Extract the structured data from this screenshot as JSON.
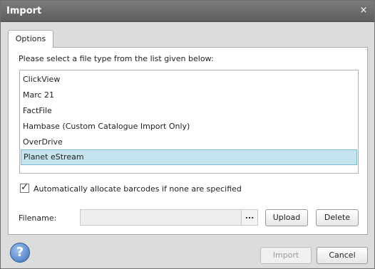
{
  "window": {
    "title": "Import",
    "close_glyph": "×"
  },
  "tabs": [
    {
      "label": "Options",
      "active": true
    }
  ],
  "options": {
    "instruction": "Please select a file type from the list given below:",
    "file_types": [
      "ClickView",
      "Marc 21",
      "FactFile",
      "Hambase (Custom Catalogue Import Only)",
      "OverDrive",
      "Planet eStream"
    ],
    "selected_file_type": "Planet eStream",
    "auto_barcode": {
      "label": "Automatically allocate barcodes if none are specified",
      "checked": true
    },
    "filename": {
      "label": "Filename:",
      "value": "",
      "browse_label": "..."
    },
    "upload_label": "Upload",
    "delete_label": "Delete"
  },
  "footer": {
    "help_glyph": "?",
    "import_label": "Import",
    "import_enabled": false,
    "cancel_label": "Cancel"
  },
  "colors": {
    "titlebar": "#6b6b6b",
    "selection": "#c6e4f0",
    "dialog_bg": "#dcdcdc"
  },
  "icons": {
    "close": "close-icon",
    "help": "help-icon",
    "check": "checkmark-icon"
  }
}
